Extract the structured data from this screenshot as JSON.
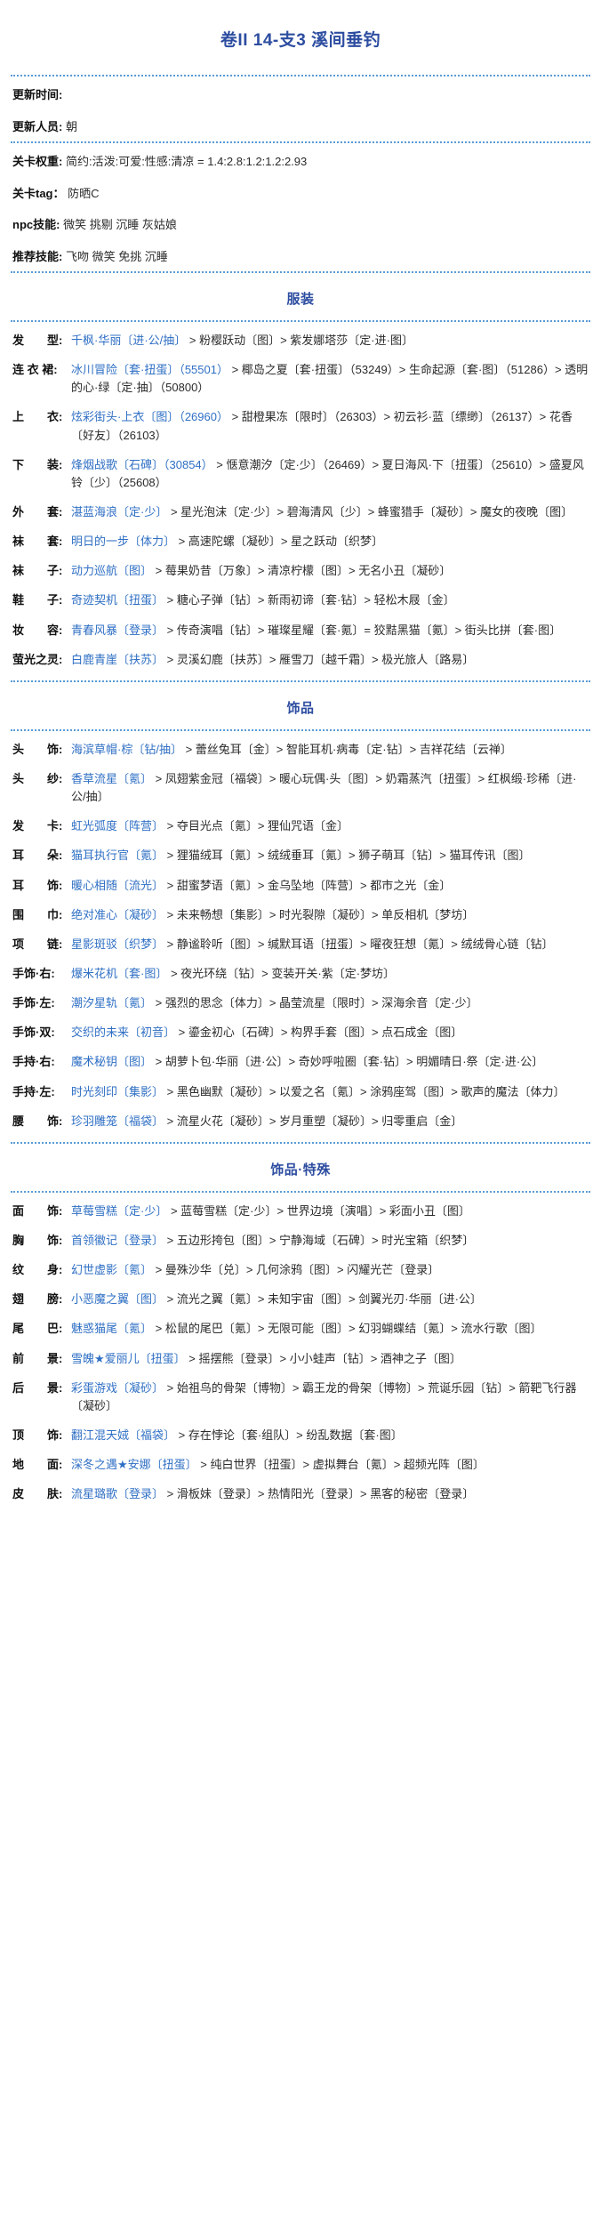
{
  "title": "卷II 14-支3 溪间垂钓",
  "meta": [
    {
      "key": "更新时间:",
      "value": ""
    },
    {
      "key": "更新人员:",
      "value": "朝"
    }
  ],
  "meta2": [
    {
      "key": "关卡权重:",
      "value": "简约:活泼:可爱:性感:清凉 = 1.4:2.8:1.2:1.2:2.93"
    },
    {
      "key": "关卡tag：",
      "value": "防晒C"
    },
    {
      "key": "npc技能:",
      "value": "微笑 挑剔 沉睡 灰姑娘"
    },
    {
      "key": "推荐技能:",
      "value": "飞吻 微笑 免挑 沉睡"
    }
  ],
  "sections": [
    {
      "heading": "服装",
      "rows": [
        {
          "label": "发　　型:",
          "chain": "千枫·华丽〔进·公/抽〕> 粉樱跃动〔图〕> 紫发娜塔莎〔定·进·图〕"
        },
        {
          "label": "连 衣 裙:",
          "chain": "冰川冒险〔套·扭蛋〕（55501）> 椰岛之夏〔套·扭蛋〕（53249）> 生命起源〔套·图〕（51286）> 透明的心·绿〔定·抽〕（50800）"
        },
        {
          "label": "上　　衣:",
          "chain": "炫彩街头·上衣〔图〕（26960）> 甜橙果冻〔限时〕（26303）> 初云衫·蓝〔缥缈〕（26137）> 花香〔好友〕（26103）"
        },
        {
          "label": "下　　装:",
          "chain": "烽烟战歌〔石碑〕（30854）> 惬意潮汐〔定·少〕（26469）> 夏日海风·下〔扭蛋〕（25610）> 盛夏风铃〔少〕（25608）"
        },
        {
          "label": "外　　套:",
          "chain": "湛蓝海浪〔定·少〕> 星光泡沫〔定·少〕> 碧海清风〔少〕> 蜂蜜猎手〔凝砂〕> 魔女的夜晚〔图〕"
        },
        {
          "label": "袜　　套:",
          "chain": "明日的一步〔体力〕> 高速陀螺〔凝砂〕> 星之跃动〔织梦〕"
        },
        {
          "label": "袜　　子:",
          "chain": "动力巡航〔图〕> 莓果奶昔〔万象〕> 清凉柠檬〔图〕> 无名小丑〔凝砂〕"
        },
        {
          "label": "鞋　　子:",
          "chain": "奇迹契机〔扭蛋〕> 糖心子弹〔钻〕> 新雨初谛〔套·钻〕> 轻松木屐〔金〕"
        },
        {
          "label": "妆　　容:",
          "chain": "青春风暴〔登录〕> 传奇演唱〔钻〕> 璀璨星耀〔套·氪〕= 狡黠黑猫〔氪〕> 街头比拼〔套·图〕"
        },
        {
          "label": "萤光之灵:",
          "chain": "白鹿青崖〔扶苏〕> 灵溪幻鹿〔扶苏〕> 雁雪刀〔越千霜〕> 极光旅人〔路易〕"
        }
      ]
    },
    {
      "heading": "饰品",
      "rows": [
        {
          "label": "头　　饰:",
          "chain": "海滨草帽·棕〔钻/抽〕> 蕾丝兔耳〔金〕> 智能耳机·病毒〔定·钻〕> 吉祥花结〔云禅〕"
        },
        {
          "label": "头　　纱:",
          "chain": "香草流星〔氪〕> 凤翅紫金冠〔福袋〕> 暖心玩偶·头〔图〕> 奶霜蒸汽〔扭蛋〕> 红枫缎·珍稀〔进·公/抽〕"
        },
        {
          "label": "发　　卡:",
          "chain": "虹光弧度〔阵营〕> 夺目光点〔氪〕> 狸仙咒语〔金〕"
        },
        {
          "label": "耳　　朵:",
          "chain": "猫耳执行官〔氪〕> 狸猫绒耳〔氪〕> 绒绒垂耳〔氪〕> 狮子萌耳〔钻〕> 猫耳传讯〔图〕"
        },
        {
          "label": "耳　　饰:",
          "chain": "暖心相随〔流光〕> 甜蜜梦语〔氪〕> 金乌坠地〔阵营〕> 都市之光〔金〕"
        },
        {
          "label": "围　　巾:",
          "chain": "绝对准心〔凝砂〕> 未来畅想〔集影〕> 时光裂隙〔凝砂〕> 单反相机〔梦坊〕"
        },
        {
          "label": "项　　链:",
          "chain": "星影斑驳〔织梦〕> 静谧聆听〔图〕> 缄默耳语〔扭蛋〕> 曜夜狂想〔氪〕> 绒绒骨心链〔钻〕"
        },
        {
          "label": "手饰·右:",
          "chain": "爆米花机〔套·图〕> 夜光环绕〔钻〕> 变装开关·紫〔定·梦坊〕"
        },
        {
          "label": "手饰·左:",
          "chain": "潮汐星轨〔氪〕> 强烈的思念〔体力〕> 晶莹流星〔限时〕> 深海余音〔定·少〕"
        },
        {
          "label": "手饰·双:",
          "chain": "交织的未来〔初音〕> 鎏金初心〔石碑〕> 构界手套〔图〕> 点石成金〔图〕"
        },
        {
          "label": "手持·右:",
          "chain": "魔术秘钥〔图〕> 胡萝卜包·华丽〔进·公〕> 奇妙呼啦圈〔套·钻〕> 明媚晴日·祭〔定·进·公〕"
        },
        {
          "label": "手持·左:",
          "chain": "时光刻印〔集影〕> 黑色幽默〔凝砂〕> 以爱之名〔氪〕> 涂鸦座驾〔图〕> 歌声的魔法〔体力〕"
        },
        {
          "label": "腰　　饰:",
          "chain": "珍羽雕笼〔福袋〕> 流星火花〔凝砂〕> 岁月重塑〔凝砂〕> 归零重启〔金〕"
        }
      ]
    },
    {
      "heading": "饰品·特殊",
      "rows": [
        {
          "label": "面　　饰:",
          "chain": "草莓雪糕〔定·少〕> 蓝莓雪糕〔定·少〕> 世界边境〔演唱〕> 彩面小丑〔图〕"
        },
        {
          "label": "胸　　饰:",
          "chain": "首领徽记〔登录〕> 五边形挎包〔图〕> 宁静海域〔石碑〕> 时光宝箱〔织梦〕"
        },
        {
          "label": "纹　　身:",
          "chain": "幻世虚影〔氪〕> 曼殊沙华〔兑〕> 几何涂鸦〔图〕> 闪耀光芒〔登录〕"
        },
        {
          "label": "翅　　膀:",
          "chain": "小恶魔之翼〔图〕> 流光之翼〔氪〕> 未知宇宙〔图〕> 剑翼光刃·华丽〔进·公〕"
        },
        {
          "label": "尾　　巴:",
          "chain": "魅惑猫尾〔氪〕> 松鼠的尾巴〔氪〕> 无限可能〔图〕> 幻羽蝴蝶结〔氪〕> 流水行歌〔图〕"
        },
        {
          "label": "前　　景:",
          "chain": "雪魄★爱丽儿〔扭蛋〕> 摇摆熊〔登录〕> 小小蛙声〔钻〕> 酒神之子〔图〕"
        },
        {
          "label": "后　　景:",
          "chain": "彩蛋游戏〔凝砂〕> 始祖鸟的骨架〔博物〕> 霸王龙的骨架〔博物〕> 荒诞乐园〔钻〕> 箭靶飞行器〔凝砂〕"
        },
        {
          "label": "顶　　饰:",
          "chain": "翻江混天娀〔福袋〕> 存在悖论〔套·组队〕> 纷乱数据〔套·图〕"
        },
        {
          "label": "地　　面:",
          "chain": "深冬之遇★安娜〔扭蛋〕> 纯白世界〔扭蛋〕> 虚拟舞台〔氪〕> 超频光阵〔图〕"
        },
        {
          "label": "皮　　肤:",
          "chain": "流星璐歌〔登录〕> 滑板妹〔登录〕> 热情阳光〔登录〕> 黑客的秘密〔登录〕"
        }
      ]
    }
  ]
}
